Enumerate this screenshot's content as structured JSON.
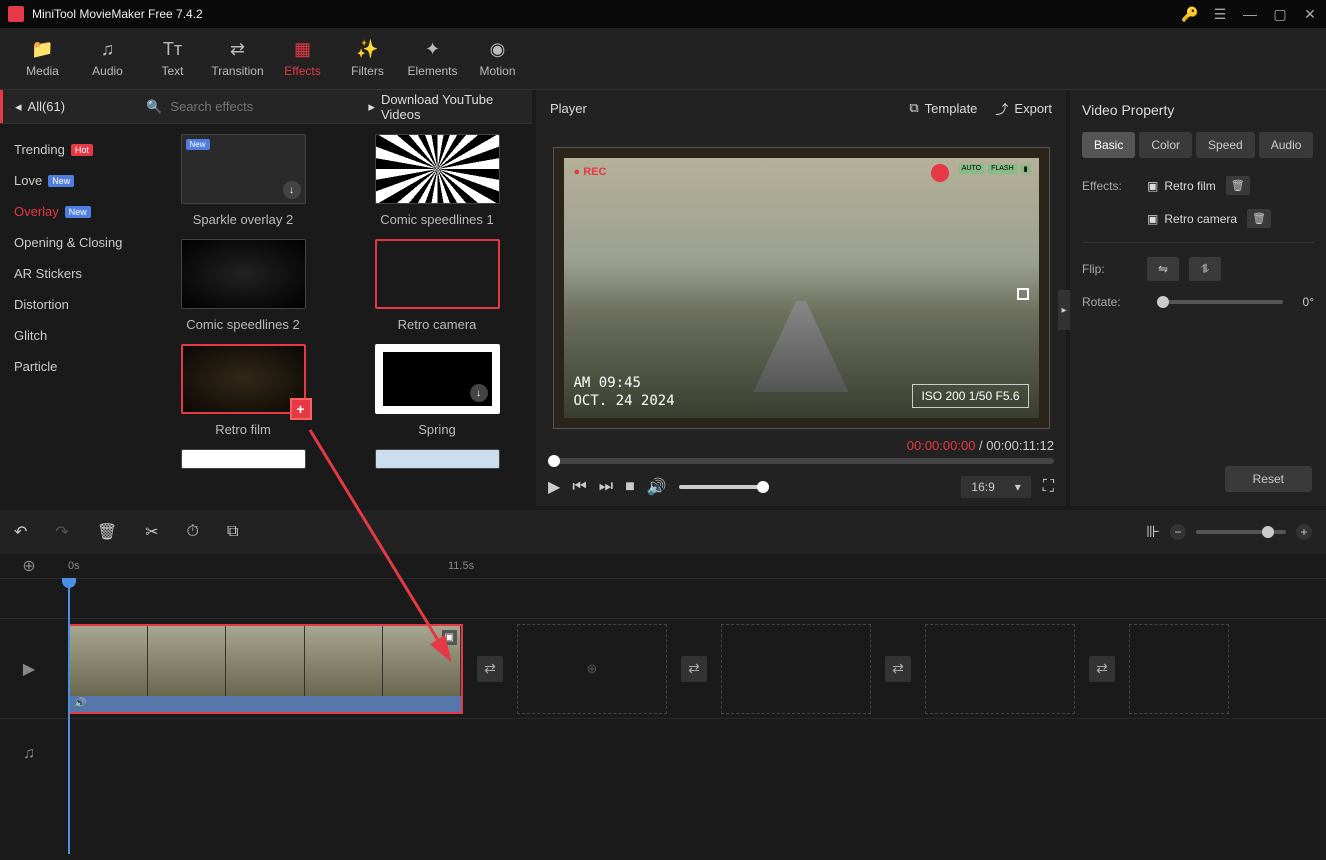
{
  "app": {
    "title": "MiniTool MovieMaker Free 7.4.2"
  },
  "toolbar": {
    "media": "Media",
    "audio": "Audio",
    "text": "Text",
    "transition": "Transition",
    "effects": "Effects",
    "filters": "Filters",
    "elements": "Elements",
    "motion": "Motion"
  },
  "filterbar": {
    "all_label": "All(61)",
    "search_placeholder": "Search effects",
    "download_yt": "Download YouTube Videos"
  },
  "categories": [
    {
      "label": "Trending",
      "badge": "Hot",
      "badge_class": "badge-hot"
    },
    {
      "label": "Love",
      "badge": "New",
      "badge_class": "badge-new"
    },
    {
      "label": "Overlay",
      "badge": "New",
      "badge_class": "badge-new",
      "active": true
    },
    {
      "label": "Opening & Closing"
    },
    {
      "label": "AR Stickers"
    },
    {
      "label": "Distortion"
    },
    {
      "label": "Glitch"
    },
    {
      "label": "Particle"
    }
  ],
  "effects": {
    "sparkle2": "Sparkle overlay 2",
    "comic1": "Comic speedlines 1",
    "comic2": "Comic speedlines 2",
    "retro_cam": "Retro camera",
    "retro_film": "Retro film",
    "spring": "Spring"
  },
  "player": {
    "title": "Player",
    "template": "Template",
    "export": "Export",
    "rec_label": "● REC",
    "timestamp_line1": "AM  09:45",
    "timestamp_line2": "OCT. 24 2024",
    "iso": "ISO 200  1/50  F5.6",
    "time_current": "00:00:00:00",
    "time_sep": " / ",
    "time_total": "00:00:11:12",
    "aspect": "16:9",
    "auto": "AUTO",
    "flash": "FLASH"
  },
  "props": {
    "title": "Video Property",
    "tabs": {
      "basic": "Basic",
      "color": "Color",
      "speed": "Speed",
      "audio": "Audio"
    },
    "effects_label": "Effects:",
    "effect1": "Retro film",
    "effect2": "Retro camera",
    "flip_label": "Flip:",
    "rotate_label": "Rotate:",
    "rotate_value": "0°",
    "reset": "Reset"
  },
  "timeline": {
    "mark0": "0s",
    "mark1": "11.5s"
  }
}
